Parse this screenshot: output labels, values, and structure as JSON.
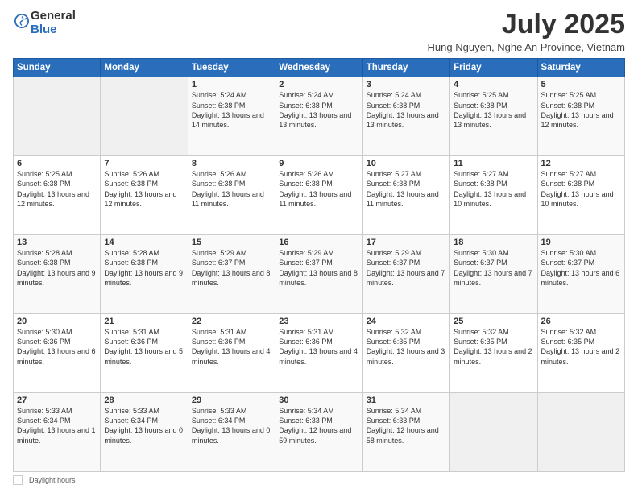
{
  "logo": {
    "general": "General",
    "blue": "Blue"
  },
  "title": "July 2025",
  "location": "Hung Nguyen, Nghe An Province, Vietnam",
  "days_header": [
    "Sunday",
    "Monday",
    "Tuesday",
    "Wednesday",
    "Thursday",
    "Friday",
    "Saturday"
  ],
  "weeks": [
    [
      {
        "num": "",
        "info": ""
      },
      {
        "num": "",
        "info": ""
      },
      {
        "num": "1",
        "info": "Sunrise: 5:24 AM\nSunset: 6:38 PM\nDaylight: 13 hours\nand 14 minutes."
      },
      {
        "num": "2",
        "info": "Sunrise: 5:24 AM\nSunset: 6:38 PM\nDaylight: 13 hours\nand 13 minutes."
      },
      {
        "num": "3",
        "info": "Sunrise: 5:24 AM\nSunset: 6:38 PM\nDaylight: 13 hours\nand 13 minutes."
      },
      {
        "num": "4",
        "info": "Sunrise: 5:25 AM\nSunset: 6:38 PM\nDaylight: 13 hours\nand 13 minutes."
      },
      {
        "num": "5",
        "info": "Sunrise: 5:25 AM\nSunset: 6:38 PM\nDaylight: 13 hours\nand 12 minutes."
      }
    ],
    [
      {
        "num": "6",
        "info": "Sunrise: 5:25 AM\nSunset: 6:38 PM\nDaylight: 13 hours\nand 12 minutes."
      },
      {
        "num": "7",
        "info": "Sunrise: 5:26 AM\nSunset: 6:38 PM\nDaylight: 13 hours\nand 12 minutes."
      },
      {
        "num": "8",
        "info": "Sunrise: 5:26 AM\nSunset: 6:38 PM\nDaylight: 13 hours\nand 11 minutes."
      },
      {
        "num": "9",
        "info": "Sunrise: 5:26 AM\nSunset: 6:38 PM\nDaylight: 13 hours\nand 11 minutes."
      },
      {
        "num": "10",
        "info": "Sunrise: 5:27 AM\nSunset: 6:38 PM\nDaylight: 13 hours\nand 11 minutes."
      },
      {
        "num": "11",
        "info": "Sunrise: 5:27 AM\nSunset: 6:38 PM\nDaylight: 13 hours\nand 10 minutes."
      },
      {
        "num": "12",
        "info": "Sunrise: 5:27 AM\nSunset: 6:38 PM\nDaylight: 13 hours\nand 10 minutes."
      }
    ],
    [
      {
        "num": "13",
        "info": "Sunrise: 5:28 AM\nSunset: 6:38 PM\nDaylight: 13 hours\nand 9 minutes."
      },
      {
        "num": "14",
        "info": "Sunrise: 5:28 AM\nSunset: 6:38 PM\nDaylight: 13 hours\nand 9 minutes."
      },
      {
        "num": "15",
        "info": "Sunrise: 5:29 AM\nSunset: 6:37 PM\nDaylight: 13 hours\nand 8 minutes."
      },
      {
        "num": "16",
        "info": "Sunrise: 5:29 AM\nSunset: 6:37 PM\nDaylight: 13 hours\nand 8 minutes."
      },
      {
        "num": "17",
        "info": "Sunrise: 5:29 AM\nSunset: 6:37 PM\nDaylight: 13 hours\nand 7 minutes."
      },
      {
        "num": "18",
        "info": "Sunrise: 5:30 AM\nSunset: 6:37 PM\nDaylight: 13 hours\nand 7 minutes."
      },
      {
        "num": "19",
        "info": "Sunrise: 5:30 AM\nSunset: 6:37 PM\nDaylight: 13 hours\nand 6 minutes."
      }
    ],
    [
      {
        "num": "20",
        "info": "Sunrise: 5:30 AM\nSunset: 6:36 PM\nDaylight: 13 hours\nand 6 minutes."
      },
      {
        "num": "21",
        "info": "Sunrise: 5:31 AM\nSunset: 6:36 PM\nDaylight: 13 hours\nand 5 minutes."
      },
      {
        "num": "22",
        "info": "Sunrise: 5:31 AM\nSunset: 6:36 PM\nDaylight: 13 hours\nand 4 minutes."
      },
      {
        "num": "23",
        "info": "Sunrise: 5:31 AM\nSunset: 6:36 PM\nDaylight: 13 hours\nand 4 minutes."
      },
      {
        "num": "24",
        "info": "Sunrise: 5:32 AM\nSunset: 6:35 PM\nDaylight: 13 hours\nand 3 minutes."
      },
      {
        "num": "25",
        "info": "Sunrise: 5:32 AM\nSunset: 6:35 PM\nDaylight: 13 hours\nand 2 minutes."
      },
      {
        "num": "26",
        "info": "Sunrise: 5:32 AM\nSunset: 6:35 PM\nDaylight: 13 hours\nand 2 minutes."
      }
    ],
    [
      {
        "num": "27",
        "info": "Sunrise: 5:33 AM\nSunset: 6:34 PM\nDaylight: 13 hours\nand 1 minute."
      },
      {
        "num": "28",
        "info": "Sunrise: 5:33 AM\nSunset: 6:34 PM\nDaylight: 13 hours\nand 0 minutes."
      },
      {
        "num": "29",
        "info": "Sunrise: 5:33 AM\nSunset: 6:34 PM\nDaylight: 13 hours\nand 0 minutes."
      },
      {
        "num": "30",
        "info": "Sunrise: 5:34 AM\nSunset: 6:33 PM\nDaylight: 12 hours\nand 59 minutes."
      },
      {
        "num": "31",
        "info": "Sunrise: 5:34 AM\nSunset: 6:33 PM\nDaylight: 12 hours\nand 58 minutes."
      },
      {
        "num": "",
        "info": ""
      },
      {
        "num": "",
        "info": ""
      }
    ]
  ],
  "footer": {
    "daylight_label": "Daylight hours"
  }
}
